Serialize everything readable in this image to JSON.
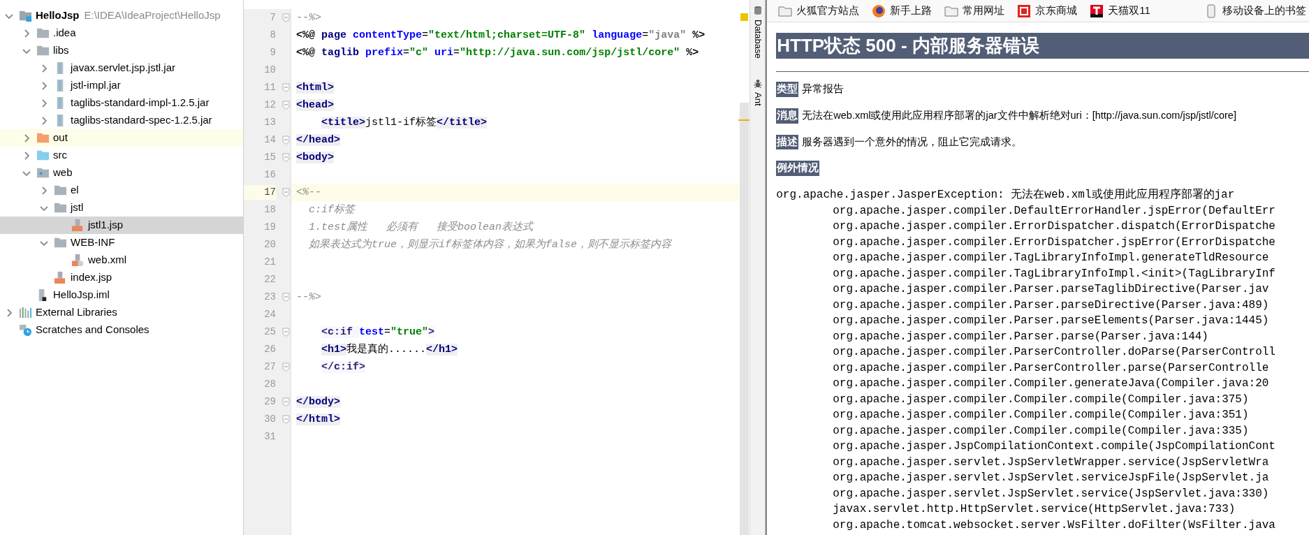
{
  "project_tree": [
    {
      "label": "HelloJsp",
      "path": "E:\\IDEA\\IdeaProject\\HelloJsp",
      "kind": "module",
      "expanded": true,
      "selected": false,
      "highlighted": false,
      "children": [
        {
          "label": ".idea",
          "kind": "folder",
          "expanded": false,
          "selected": false,
          "highlighted": false
        },
        {
          "label": "libs",
          "kind": "folder",
          "expanded": true,
          "selected": false,
          "highlighted": false,
          "children": [
            {
              "label": "javax.servlet.jsp.jstl.jar",
              "kind": "jar",
              "expanded": false,
              "selected": false,
              "highlighted": false
            },
            {
              "label": "jstl-impl.jar",
              "kind": "jar",
              "expanded": false,
              "selected": false,
              "highlighted": false
            },
            {
              "label": "taglibs-standard-impl-1.2.5.jar",
              "kind": "jar",
              "expanded": false,
              "selected": false,
              "highlighted": false
            },
            {
              "label": "taglibs-standard-spec-1.2.5.jar",
              "kind": "jar",
              "expanded": false,
              "selected": false,
              "highlighted": false
            }
          ]
        },
        {
          "label": "out",
          "kind": "excluded",
          "expanded": false,
          "selected": false,
          "highlighted": true
        },
        {
          "label": "src",
          "kind": "source",
          "expanded": false,
          "selected": false,
          "highlighted": false
        },
        {
          "label": "web",
          "kind": "webroot",
          "expanded": true,
          "selected": false,
          "highlighted": false,
          "children": [
            {
              "label": "el",
              "kind": "folder",
              "expanded": false,
              "selected": false,
              "highlighted": false
            },
            {
              "label": "jstl",
              "kind": "folder",
              "expanded": true,
              "selected": false,
              "highlighted": false,
              "children": [
                {
                  "label": "jstl1.jsp",
                  "kind": "jsp",
                  "selected": true,
                  "highlighted": false
                }
              ]
            },
            {
              "label": "WEB-INF",
              "kind": "folder",
              "expanded": true,
              "selected": false,
              "highlighted": false,
              "children": [
                {
                  "label": "web.xml",
                  "kind": "xml",
                  "selected": false,
                  "highlighted": false
                }
              ]
            },
            {
              "label": "index.jsp",
              "kind": "jsp",
              "selected": false,
              "highlighted": false
            }
          ]
        },
        {
          "label": "HelloJsp.iml",
          "kind": "iml",
          "selected": false,
          "highlighted": false
        }
      ]
    },
    {
      "label": "External Libraries",
      "kind": "libraries",
      "expanded": false,
      "selected": false,
      "highlighted": false
    },
    {
      "label": "Scratches and Consoles",
      "kind": "scratches",
      "selected": false,
      "highlighted": false
    }
  ],
  "editor": {
    "lines": [
      {
        "number": "7",
        "fold": true,
        "current": false,
        "tokens": [
          {
            "text": "--%>",
            "kind": "comment"
          }
        ]
      },
      {
        "number": "8",
        "fold": false,
        "current": false,
        "tokens": [
          {
            "text": "<%@ ",
            "kind": "directive"
          },
          {
            "text": "page ",
            "kind": "keyword"
          },
          {
            "text": "contentType",
            "kind": "attr"
          },
          {
            "text": "=",
            "kind": "plain"
          },
          {
            "text": "\"text/html;charset=UTF-8\" ",
            "kind": "value"
          },
          {
            "text": "language",
            "kind": "attr"
          },
          {
            "text": "=",
            "kind": "plain"
          },
          {
            "text": "\"java\"",
            "kind": "muted"
          },
          {
            "text": " %>",
            "kind": "directive"
          }
        ]
      },
      {
        "number": "9",
        "fold": false,
        "current": false,
        "tokens": [
          {
            "text": "<%@ ",
            "kind": "directive"
          },
          {
            "text": "taglib ",
            "kind": "keyword"
          },
          {
            "text": "prefix",
            "kind": "attr"
          },
          {
            "text": "=",
            "kind": "plain"
          },
          {
            "text": "\"c\" ",
            "kind": "value"
          },
          {
            "text": "uri",
            "kind": "attr"
          },
          {
            "text": "=",
            "kind": "plain"
          },
          {
            "text": "\"http://java.sun.com/jsp/jstl/core\"",
            "kind": "value"
          },
          {
            "text": " %>",
            "kind": "directive"
          }
        ]
      },
      {
        "number": "10",
        "fold": false,
        "current": false
      },
      {
        "number": "11",
        "fold": true,
        "current": false,
        "tokens": [
          {
            "text": "<html>",
            "kind": "tag"
          }
        ]
      },
      {
        "number": "12",
        "fold": true,
        "current": false,
        "tokens": [
          {
            "text": "<head>",
            "kind": "tag"
          }
        ]
      },
      {
        "number": "13",
        "fold": false,
        "current": false,
        "tokens": [
          {
            "text": "    <title>",
            "kind": "tag"
          },
          {
            "text": "jstl1-if标签",
            "kind": "text"
          },
          {
            "text": "</title>",
            "kind": "tag"
          }
        ]
      },
      {
        "number": "14",
        "fold": true,
        "current": false,
        "tokens": [
          {
            "text": "</head>",
            "kind": "tag"
          }
        ]
      },
      {
        "number": "15",
        "fold": true,
        "current": false,
        "tokens": [
          {
            "text": "<body>",
            "kind": "tag"
          }
        ]
      },
      {
        "number": "16",
        "fold": false,
        "current": false
      },
      {
        "number": "17",
        "fold": true,
        "current": true,
        "tokens": [
          {
            "text": "<%--",
            "kind": "comment"
          }
        ]
      },
      {
        "number": "18",
        "fold": false,
        "current": false,
        "tokens": [
          {
            "text": "  c:if标签",
            "kind": "comment"
          }
        ]
      },
      {
        "number": "19",
        "fold": false,
        "current": false,
        "tokens": [
          {
            "text": "  1.test属性   必须有   接受boolean表达式",
            "kind": "comment"
          }
        ]
      },
      {
        "number": "20",
        "fold": false,
        "current": false,
        "tokens": [
          {
            "text": "  如果表达式为true，则显示if标签体内容，如果为false，则不显示标签内容",
            "kind": "comment"
          }
        ]
      },
      {
        "number": "21",
        "fold": false,
        "current": false
      },
      {
        "number": "22",
        "fold": false,
        "current": false
      },
      {
        "number": "23",
        "fold": true,
        "current": false,
        "tokens": [
          {
            "text": "--%>",
            "kind": "comment"
          }
        ]
      },
      {
        "number": "24",
        "fold": false,
        "current": false
      },
      {
        "number": "25",
        "fold": true,
        "current": false,
        "tokens": [
          {
            "text": "    <c:if ",
            "kind": "ctag"
          },
          {
            "text": "test",
            "kind": "attr"
          },
          {
            "text": "=",
            "kind": "plain"
          },
          {
            "text": "\"true\"",
            "kind": "value"
          },
          {
            "text": ">",
            "kind": "ctag"
          }
        ]
      },
      {
        "number": "26",
        "fold": false,
        "current": false,
        "tokens": [
          {
            "text": "    <h1>",
            "kind": "tag"
          },
          {
            "text": "我是真的......",
            "kind": "text"
          },
          {
            "text": "</h1>",
            "kind": "tag"
          }
        ]
      },
      {
        "number": "27",
        "fold": true,
        "current": false,
        "tokens": [
          {
            "text": "    </c:if>",
            "kind": "ctag"
          }
        ]
      },
      {
        "number": "28",
        "fold": false,
        "current": false
      },
      {
        "number": "29",
        "fold": true,
        "current": false,
        "tokens": [
          {
            "text": "</body>",
            "kind": "tag"
          }
        ]
      },
      {
        "number": "30",
        "fold": true,
        "current": false,
        "tokens": [
          {
            "text": "</html>",
            "kind": "tag"
          }
        ]
      },
      {
        "number": "31",
        "fold": false,
        "current": false
      }
    ]
  },
  "tool_windows": [
    {
      "label": "Database",
      "kind": "database"
    },
    {
      "label": "Ant",
      "kind": "ant"
    }
  ],
  "browser": {
    "bookmarks": [
      {
        "label": "火狐官方站点",
        "kind": "folder"
      },
      {
        "label": "新手上路",
        "kind": "firefox"
      },
      {
        "label": "常用网址",
        "kind": "folder"
      },
      {
        "label": "京东商城",
        "kind": "jd"
      },
      {
        "label": "天猫双11",
        "kind": "tmall"
      }
    ],
    "mobile_bookmarks": "移动设备上的书签",
    "heading": "HTTP状态 500 - 内部服务器错误",
    "fields": [
      {
        "label": "类型",
        "text": "异常报告"
      },
      {
        "label": "消息",
        "text": "无法在web.xml或使用此应用程序部署的jar文件中解析绝对uri：[http://java.sun.com/jsp/jstl/core]"
      },
      {
        "label": "描述",
        "text": "服务器遇到一个意外的情况，阻止它完成请求。"
      }
    ],
    "exception_label": "例外情况",
    "exception": "org.apache.jasper.JasperException: 无法在web.xml或使用此应用程序部署的jar",
    "frames": [
      "org.apache.jasper.compiler.DefaultErrorHandler.jspError(DefaultErr",
      "org.apache.jasper.compiler.ErrorDispatcher.dispatch(ErrorDispatche",
      "org.apache.jasper.compiler.ErrorDispatcher.jspError(ErrorDispatche",
      "org.apache.jasper.compiler.TagLibraryInfoImpl.generateTldResource",
      "org.apache.jasper.compiler.TagLibraryInfoImpl.<init>(TagLibraryInf",
      "org.apache.jasper.compiler.Parser.parseTaglibDirective(Parser.jav",
      "org.apache.jasper.compiler.Parser.parseDirective(Parser.java:489)",
      "org.apache.jasper.compiler.Parser.parseElements(Parser.java:1445)",
      "org.apache.jasper.compiler.Parser.parse(Parser.java:144)",
      "org.apache.jasper.compiler.ParserController.doParse(ParserControll",
      "org.apache.jasper.compiler.ParserController.parse(ParserControlle",
      "org.apache.jasper.compiler.Compiler.generateJava(Compiler.java:20",
      "org.apache.jasper.compiler.Compiler.compile(Compiler.java:375)",
      "org.apache.jasper.compiler.Compiler.compile(Compiler.java:351)",
      "org.apache.jasper.compiler.Compiler.compile(Compiler.java:335)",
      "org.apache.jasper.JspCompilationContext.compile(JspCompilationCont",
      "org.apache.jasper.servlet.JspServletWrapper.service(JspServletWra",
      "org.apache.jasper.servlet.JspServlet.serviceJspFile(JspServlet.ja",
      "org.apache.jasper.servlet.JspServlet.service(JspServlet.java:330)",
      "javax.servlet.http.HttpServlet.service(HttpServlet.java:733)",
      "org.apache.tomcat.websocket.server.WsFilter.doFilter(WsFilter.java"
    ]
  }
}
